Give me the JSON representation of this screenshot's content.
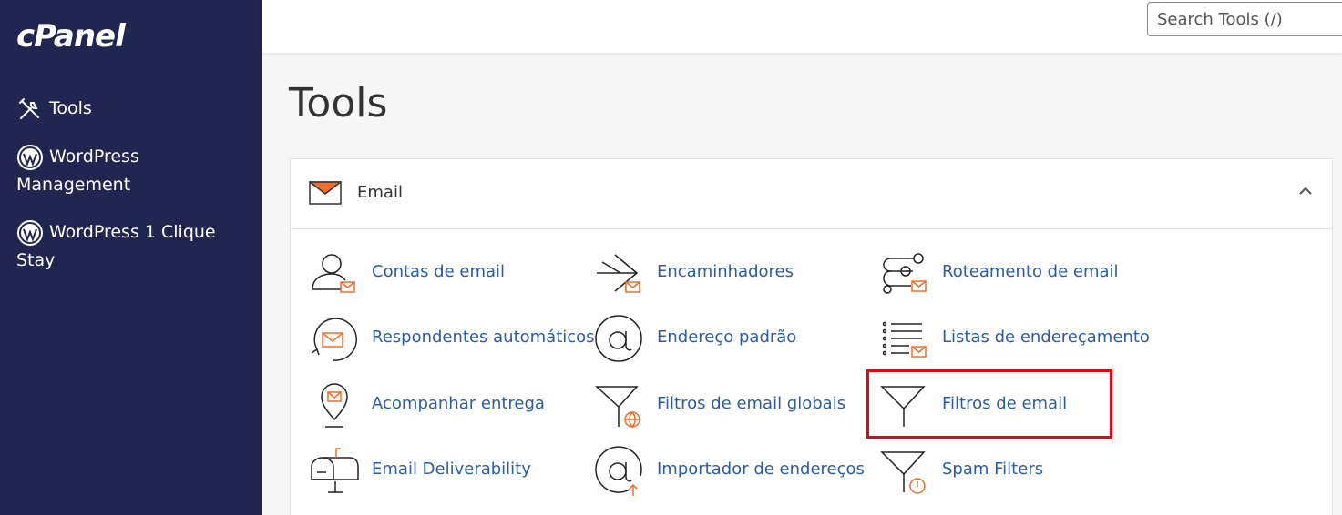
{
  "brand": {
    "logo_text": "cPanel"
  },
  "sidebar": {
    "items": [
      {
        "label": "Tools",
        "icon": "tools-icon"
      },
      {
        "label": "WordPress Management",
        "icon": "wordpress-icon"
      },
      {
        "label": "WordPress 1 Clique Stay",
        "icon": "wordpress-icon"
      }
    ]
  },
  "header": {
    "search_placeholder": "Search Tools (/)"
  },
  "main": {
    "title": "Tools",
    "section": {
      "title": "Email",
      "tools": [
        {
          "label": "Contas de email",
          "icon": "email-accounts-icon"
        },
        {
          "label": "Encaminhadores",
          "icon": "forwarders-icon"
        },
        {
          "label": "Roteamento de email",
          "icon": "email-routing-icon"
        },
        {
          "label": "Respondentes automáticos",
          "icon": "autoresponders-icon"
        },
        {
          "label": "Endereço padrão",
          "icon": "default-address-icon"
        },
        {
          "label": "Listas de endereçamento",
          "icon": "mailing-lists-icon"
        },
        {
          "label": "Acompanhar entrega",
          "icon": "track-delivery-icon"
        },
        {
          "label": "Filtros de email globais",
          "icon": "global-email-filters-icon"
        },
        {
          "label": "Filtros de email",
          "icon": "email-filters-icon"
        },
        {
          "label": "Email Deliverability",
          "icon": "email-deliverability-icon"
        },
        {
          "label": "Importador de endereços",
          "icon": "address-importer-icon"
        },
        {
          "label": "Spam Filters",
          "icon": "spam-filters-icon"
        }
      ]
    }
  },
  "colors": {
    "sidebar_bg": "#20264f",
    "link": "#2c5ca3",
    "accent": "#f26c2a",
    "highlight": "#e30613"
  }
}
